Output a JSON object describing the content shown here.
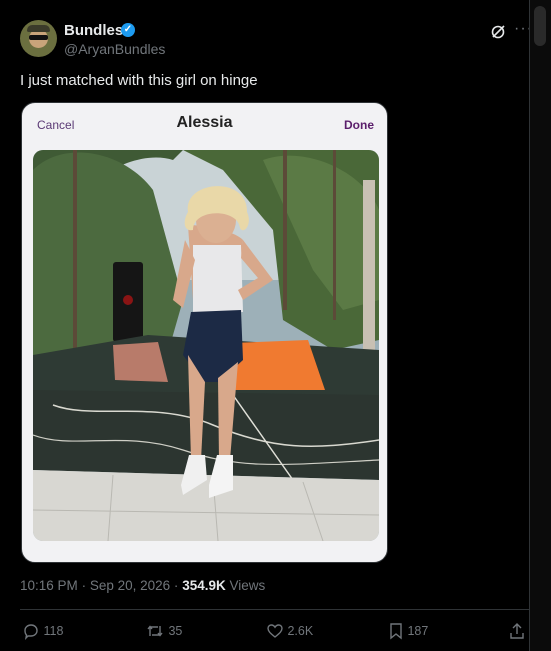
{
  "tweet": {
    "author_name": "Bundles",
    "handle": "@AryanBundles",
    "text": "I just matched with this girl on hinge",
    "time": "10:16 PM",
    "date": "Sep 20, 2026",
    "separator": "·",
    "views_count": "354.9K",
    "views_label": "Views"
  },
  "card": {
    "cancel_label": "Cancel",
    "title": "Alessia",
    "done_label": "Done"
  },
  "actions": {
    "replies": "118",
    "reposts": "35",
    "likes": "2.6K",
    "bookmarks": "187"
  },
  "icons": [
    "grok-icon",
    "more-icon",
    "reply-icon",
    "repost-icon",
    "like-icon",
    "bookmark-icon",
    "share-icon",
    "verified-badge-icon"
  ],
  "colors": {
    "background": "#000000",
    "text": "#e7e9ea",
    "muted": "#71767b",
    "verified": "#1d9bf0",
    "hinge_purple": "#5b1f6b"
  }
}
